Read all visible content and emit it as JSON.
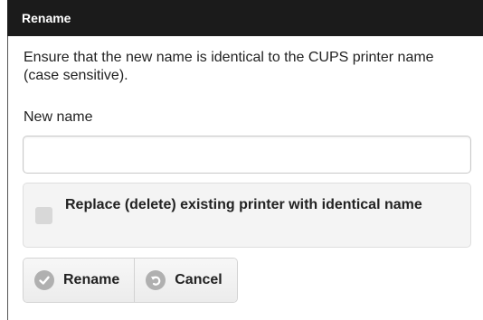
{
  "dialog": {
    "title": "Rename",
    "description": "Ensure that the new name is identical to the CUPS printer name (case sensitive).",
    "new_name_label": "New name",
    "new_name_value": "",
    "new_name_placeholder": "",
    "replace_checkbox": {
      "label": "Replace (delete) existing printer with identical name",
      "checked": false
    },
    "buttons": {
      "rename": {
        "label": "Rename",
        "icon": "check-icon"
      },
      "cancel": {
        "label": "Cancel",
        "icon": "back-arrow-icon"
      }
    }
  },
  "colors": {
    "title_bar": "#1b1b1b",
    "title_text": "#ffffff",
    "icon_gray": "#b0b0b0"
  }
}
